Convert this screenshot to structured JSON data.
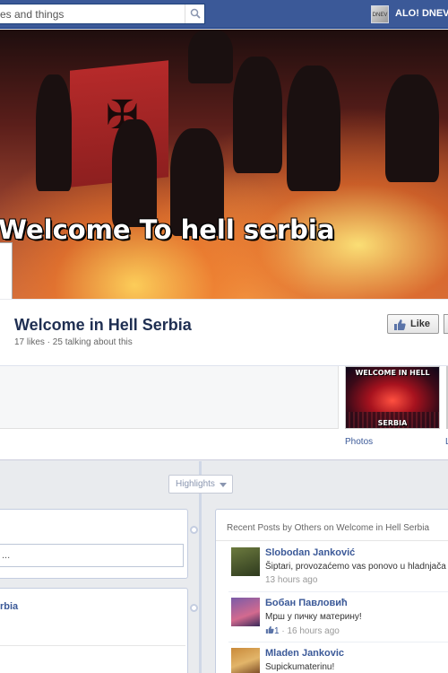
{
  "topbar": {
    "search_value": "es and things",
    "profile_badge": "DNEV",
    "profile_name": "ALO! DNEV"
  },
  "cover": {
    "overlay_text": "Welcome To hell serbia"
  },
  "page": {
    "title": "Welcome in Hell Serbia",
    "stats": "17 likes · 25 talking about this",
    "like_button": "Like"
  },
  "photos": {
    "thumb_top_text": "WELCOME IN HELL",
    "thumb_bottom_text": "SERBIA",
    "label": "Photos",
    "next_label": "L"
  },
  "timeline": {
    "highlights_label": "Highlights",
    "left_card_2_title": "rbia"
  },
  "recent_posts": {
    "title": "Recent Posts by Others on Welcome in Hell Serbia",
    "items": [
      {
        "author": "Slobodan Janković",
        "text": "Šiptari, provozaćemo vas ponovo u hladnjača",
        "meta": "13 hours ago",
        "likes": ""
      },
      {
        "author": "Бобан Павловић",
        "text": "Мрш у пичку материну!",
        "meta": "· 16 hours ago",
        "likes": "1"
      },
      {
        "author": "Mladen Jankovic",
        "text": "Supickumaterinu!",
        "meta": "",
        "likes": ""
      }
    ]
  },
  "colors": {
    "facebook_blue": "#3b5998",
    "like_blue": "#3b5998"
  }
}
